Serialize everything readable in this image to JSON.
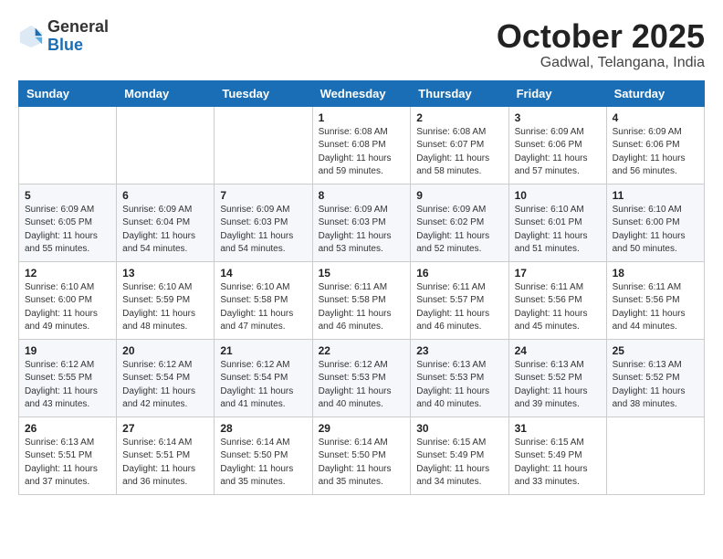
{
  "header": {
    "logo": {
      "general": "General",
      "blue": "Blue"
    },
    "month": "October 2025",
    "location": "Gadwal, Telangana, India"
  },
  "days_of_week": [
    "Sunday",
    "Monday",
    "Tuesday",
    "Wednesday",
    "Thursday",
    "Friday",
    "Saturday"
  ],
  "weeks": [
    [
      {
        "day": "",
        "info": ""
      },
      {
        "day": "",
        "info": ""
      },
      {
        "day": "",
        "info": ""
      },
      {
        "day": "1",
        "info": "Sunrise: 6:08 AM\nSunset: 6:08 PM\nDaylight: 11 hours\nand 59 minutes."
      },
      {
        "day": "2",
        "info": "Sunrise: 6:08 AM\nSunset: 6:07 PM\nDaylight: 11 hours\nand 58 minutes."
      },
      {
        "day": "3",
        "info": "Sunrise: 6:09 AM\nSunset: 6:06 PM\nDaylight: 11 hours\nand 57 minutes."
      },
      {
        "day": "4",
        "info": "Sunrise: 6:09 AM\nSunset: 6:06 PM\nDaylight: 11 hours\nand 56 minutes."
      }
    ],
    [
      {
        "day": "5",
        "info": "Sunrise: 6:09 AM\nSunset: 6:05 PM\nDaylight: 11 hours\nand 55 minutes."
      },
      {
        "day": "6",
        "info": "Sunrise: 6:09 AM\nSunset: 6:04 PM\nDaylight: 11 hours\nand 54 minutes."
      },
      {
        "day": "7",
        "info": "Sunrise: 6:09 AM\nSunset: 6:03 PM\nDaylight: 11 hours\nand 54 minutes."
      },
      {
        "day": "8",
        "info": "Sunrise: 6:09 AM\nSunset: 6:03 PM\nDaylight: 11 hours\nand 53 minutes."
      },
      {
        "day": "9",
        "info": "Sunrise: 6:09 AM\nSunset: 6:02 PM\nDaylight: 11 hours\nand 52 minutes."
      },
      {
        "day": "10",
        "info": "Sunrise: 6:10 AM\nSunset: 6:01 PM\nDaylight: 11 hours\nand 51 minutes."
      },
      {
        "day": "11",
        "info": "Sunrise: 6:10 AM\nSunset: 6:00 PM\nDaylight: 11 hours\nand 50 minutes."
      }
    ],
    [
      {
        "day": "12",
        "info": "Sunrise: 6:10 AM\nSunset: 6:00 PM\nDaylight: 11 hours\nand 49 minutes."
      },
      {
        "day": "13",
        "info": "Sunrise: 6:10 AM\nSunset: 5:59 PM\nDaylight: 11 hours\nand 48 minutes."
      },
      {
        "day": "14",
        "info": "Sunrise: 6:10 AM\nSunset: 5:58 PM\nDaylight: 11 hours\nand 47 minutes."
      },
      {
        "day": "15",
        "info": "Sunrise: 6:11 AM\nSunset: 5:58 PM\nDaylight: 11 hours\nand 46 minutes."
      },
      {
        "day": "16",
        "info": "Sunrise: 6:11 AM\nSunset: 5:57 PM\nDaylight: 11 hours\nand 46 minutes."
      },
      {
        "day": "17",
        "info": "Sunrise: 6:11 AM\nSunset: 5:56 PM\nDaylight: 11 hours\nand 45 minutes."
      },
      {
        "day": "18",
        "info": "Sunrise: 6:11 AM\nSunset: 5:56 PM\nDaylight: 11 hours\nand 44 minutes."
      }
    ],
    [
      {
        "day": "19",
        "info": "Sunrise: 6:12 AM\nSunset: 5:55 PM\nDaylight: 11 hours\nand 43 minutes."
      },
      {
        "day": "20",
        "info": "Sunrise: 6:12 AM\nSunset: 5:54 PM\nDaylight: 11 hours\nand 42 minutes."
      },
      {
        "day": "21",
        "info": "Sunrise: 6:12 AM\nSunset: 5:54 PM\nDaylight: 11 hours\nand 41 minutes."
      },
      {
        "day": "22",
        "info": "Sunrise: 6:12 AM\nSunset: 5:53 PM\nDaylight: 11 hours\nand 40 minutes."
      },
      {
        "day": "23",
        "info": "Sunrise: 6:13 AM\nSunset: 5:53 PM\nDaylight: 11 hours\nand 40 minutes."
      },
      {
        "day": "24",
        "info": "Sunrise: 6:13 AM\nSunset: 5:52 PM\nDaylight: 11 hours\nand 39 minutes."
      },
      {
        "day": "25",
        "info": "Sunrise: 6:13 AM\nSunset: 5:52 PM\nDaylight: 11 hours\nand 38 minutes."
      }
    ],
    [
      {
        "day": "26",
        "info": "Sunrise: 6:13 AM\nSunset: 5:51 PM\nDaylight: 11 hours\nand 37 minutes."
      },
      {
        "day": "27",
        "info": "Sunrise: 6:14 AM\nSunset: 5:51 PM\nDaylight: 11 hours\nand 36 minutes."
      },
      {
        "day": "28",
        "info": "Sunrise: 6:14 AM\nSunset: 5:50 PM\nDaylight: 11 hours\nand 35 minutes."
      },
      {
        "day": "29",
        "info": "Sunrise: 6:14 AM\nSunset: 5:50 PM\nDaylight: 11 hours\nand 35 minutes."
      },
      {
        "day": "30",
        "info": "Sunrise: 6:15 AM\nSunset: 5:49 PM\nDaylight: 11 hours\nand 34 minutes."
      },
      {
        "day": "31",
        "info": "Sunrise: 6:15 AM\nSunset: 5:49 PM\nDaylight: 11 hours\nand 33 minutes."
      },
      {
        "day": "",
        "info": ""
      }
    ]
  ]
}
